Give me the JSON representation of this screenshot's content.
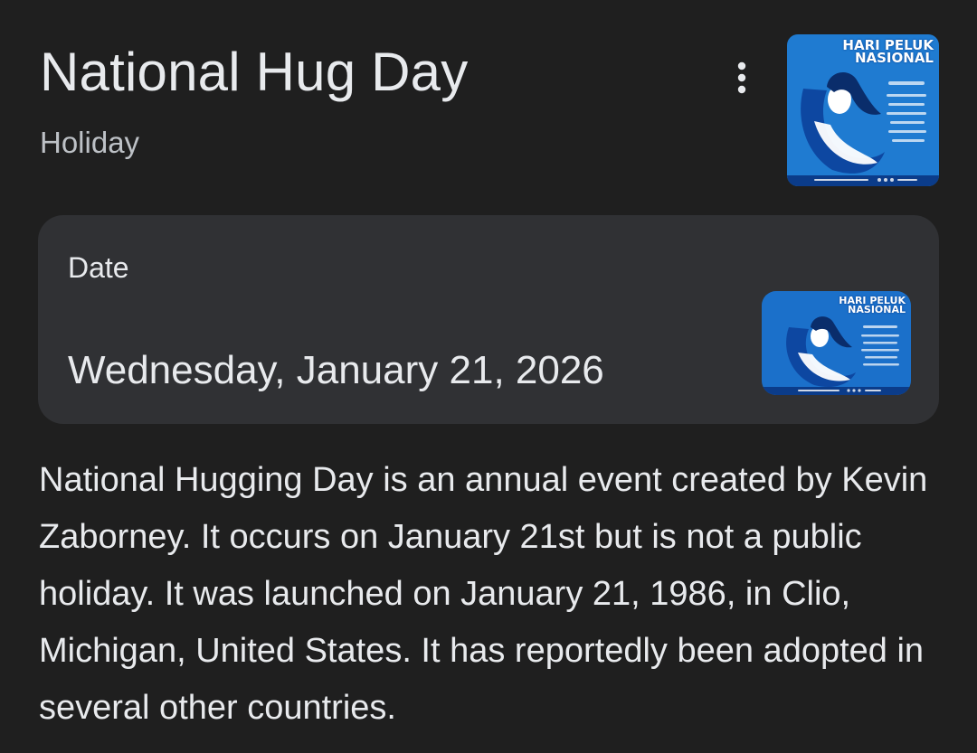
{
  "header": {
    "title": "National Hug Day",
    "subtitle": "Holiday"
  },
  "menu": {
    "icon": "more-vert-icon"
  },
  "thumbnail": {
    "text_line1": "HARI PELUK",
    "text_line2": "NASIONAL",
    "background_color": "#1565c0"
  },
  "date_card": {
    "label": "Date",
    "value": "Wednesday, January 21, 2026"
  },
  "description": "National Hugging Day is an annual event created by Kevin Zaborney. It occurs on January 21st but is not a public holiday. It was launched on January 21, 1986, in Clio, Michigan, United States. It has reportedly been adopted in several other countries.",
  "colors": {
    "background": "#1f1f1f",
    "card": "#303134",
    "text_primary": "#e8eaed",
    "text_secondary": "#bdc1c6"
  }
}
